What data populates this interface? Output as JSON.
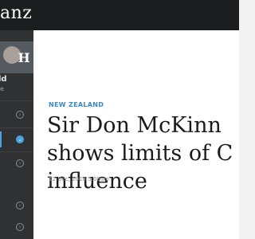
{
  "header": {
    "brand": "anz"
  },
  "sidebar": {
    "author_name": "ld",
    "author_sub": "e",
    "badge_glyph": "H",
    "menu": [
      {
        "icon": "chevron-right-icon",
        "active": false
      },
      {
        "icon": "chevron-down-icon",
        "active": true
      },
      {
        "icon": "chevron-right-icon",
        "active": false
      },
      {
        "icon": "chevron-right-icon",
        "active": false
      },
      {
        "icon": "chevron-right-icon",
        "active": false
      }
    ]
  },
  "article": {
    "section": "NEW ZEALAND",
    "headline_lines": [
      "Sir Don McKinn",
      "shows limits of C",
      "influence"
    ],
    "dateline": "12 Dec, 2018 5:00am"
  },
  "colors": {
    "accent": "#4aa3de",
    "topbar": "#1b1d1f",
    "sidebar": "#2f3133"
  }
}
